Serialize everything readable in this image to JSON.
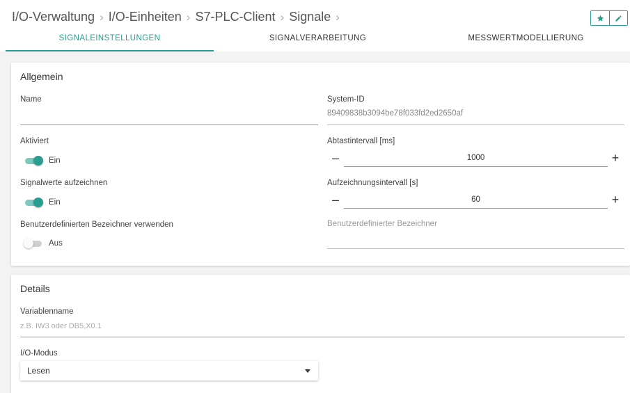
{
  "breadcrumb": [
    "I/O-Verwaltung",
    "I/O-Einheiten",
    "S7-PLC-Client",
    "Signale"
  ],
  "header_buttons": {
    "favorite_icon": "star-icon",
    "edit_icon": "pencil-icon"
  },
  "tabs": [
    {
      "label": "SIGNALEINSTELLUNGEN",
      "active": true
    },
    {
      "label": "SIGNALVERARBEITUNG",
      "active": false
    },
    {
      "label": "MESSWERTMODELLIERUNG",
      "active": false
    }
  ],
  "general": {
    "title": "Allgemein",
    "name_label": "Name",
    "name_value": "",
    "system_id_label": "System-ID",
    "system_id_value": "89409838b3094be78f033fd2ed2650af",
    "activated_label": "Aktiviert",
    "activated_state": "Ein",
    "sampling_label": "Abtastintervall [ms]",
    "sampling_value": "1000",
    "record_label": "Signalwerte aufzeichnen",
    "record_state": "Ein",
    "record_interval_label": "Aufzeichnungsintervall [s]",
    "record_interval_value": "60",
    "custom_id_label": "Benutzerdefinierten Bezeichner verwenden",
    "custom_id_state": "Aus",
    "custom_id_field_label": "Benutzerdefinierter Bezeichner",
    "decrement_symbol": "–",
    "increment_symbol": "+"
  },
  "details": {
    "title": "Details",
    "variable_label": "Variablenname",
    "variable_placeholder": "z.B. IW3 oder DB5,X0.1",
    "io_mode_label": "I/O-Modus",
    "io_mode_value": "Lesen"
  },
  "colors": {
    "accent": "#2a9d8f",
    "background": "#f3f3f3",
    "card": "#ffffff"
  }
}
